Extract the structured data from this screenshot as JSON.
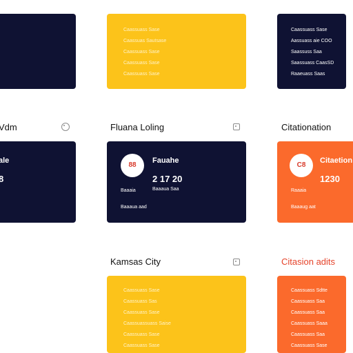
{
  "top_row": {
    "left_card": {},
    "center_card": {
      "lines": [
        "Caassuass Sase",
        "Caassuas Sautsase",
        "Caassuass Sase",
        "Caassuass Sase",
        "Caassuass Sase"
      ]
    },
    "right_card": {
      "lines": [
        "Caassuass Sase",
        "Aassuass aie COO",
        "Saassuss Saa",
        "Saassuass CaasSD",
        "Raaeuass Saas"
      ]
    }
  },
  "middle_row": {
    "left_col": {
      "heading": "Vdm",
      "card": {
        "title": "ale",
        "value": "8"
      }
    },
    "center_col": {
      "heading": "Fluana Loling",
      "card": {
        "badge": "88",
        "title": "Fauahe",
        "value": "2 17 20",
        "label": "Baaaia",
        "sub": "Baaaua Saa",
        "footer": "Baaaua aad"
      }
    },
    "right_col": {
      "heading": "Citationation",
      "card": {
        "badge": "C8",
        "title": "Citaetion",
        "value": "1230",
        "label": "Raaaia",
        "footer": "Baaaug aat"
      }
    }
  },
  "bottom_row": {
    "center_col": {
      "heading": "Kamsas City",
      "lines": [
        "Caassuass Sase",
        "Caassuass Sas",
        "Caassuass Sase",
        "Caassuassuass Saise",
        "Caassuass Sase",
        "Caassuass Sase"
      ]
    },
    "right_col": {
      "heading": "Citasion adits",
      "lines": [
        "Caassuass Sdtte",
        "Caassuass Saa",
        "Caassuass Saa",
        "Caassuass Saaa",
        "Caassuass Saa",
        "Caassuass Sase"
      ]
    }
  },
  "colors": {
    "navy": "#0f1233",
    "yellow": "#fcc31a",
    "orange": "#fb6a2c",
    "accent_red": "#e5432a"
  },
  "icons": [
    "info-circle-icon",
    "expand-square-icon",
    "expand-square-icon"
  ]
}
